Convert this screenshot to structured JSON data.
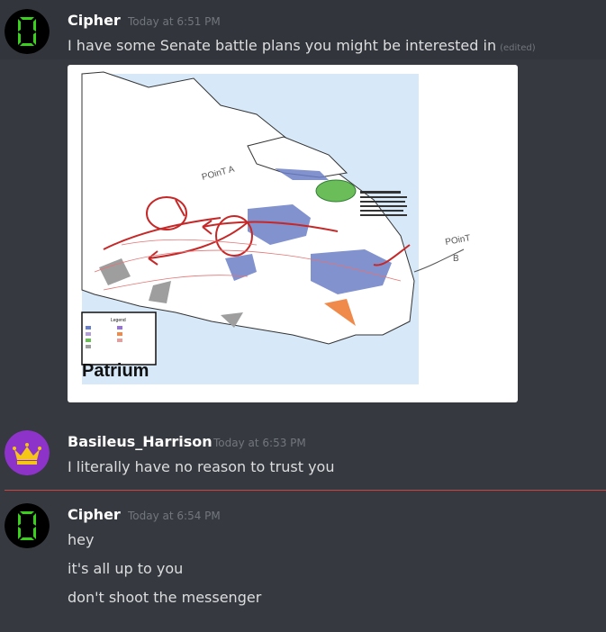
{
  "messages": [
    {
      "author": "Cipher",
      "timestamp": "Today at 6:51 PM",
      "lines": [
        "I have some Senate battle plans you might be interested in"
      ],
      "edited_label": "(edited)",
      "avatar_icon": "seven-segment-zero-avatar",
      "attachment": {
        "map_title": "Patrium",
        "legend_title": "Legend",
        "annotations": [
          "Point A",
          "Point B"
        ]
      }
    },
    {
      "author": "Basileus_Harrison",
      "timestamp": "Today at 6:53 PM",
      "lines": [
        "I literally have no reason to trust you"
      ],
      "avatar_icon": "crown-avatar"
    },
    {
      "author": "Cipher",
      "timestamp": "Today at 6:54 PM",
      "lines": [
        "hey",
        "it's all up to you",
        "don't shoot the messenger"
      ],
      "avatar_icon": "seven-segment-zero-avatar"
    }
  ],
  "colors": {
    "background": "#36393f",
    "new_message_divider": "#f04747",
    "digit_green": "#39d11c",
    "crown_avatar_bg": "#8e33c9",
    "crown_gold": "#f5c518"
  }
}
